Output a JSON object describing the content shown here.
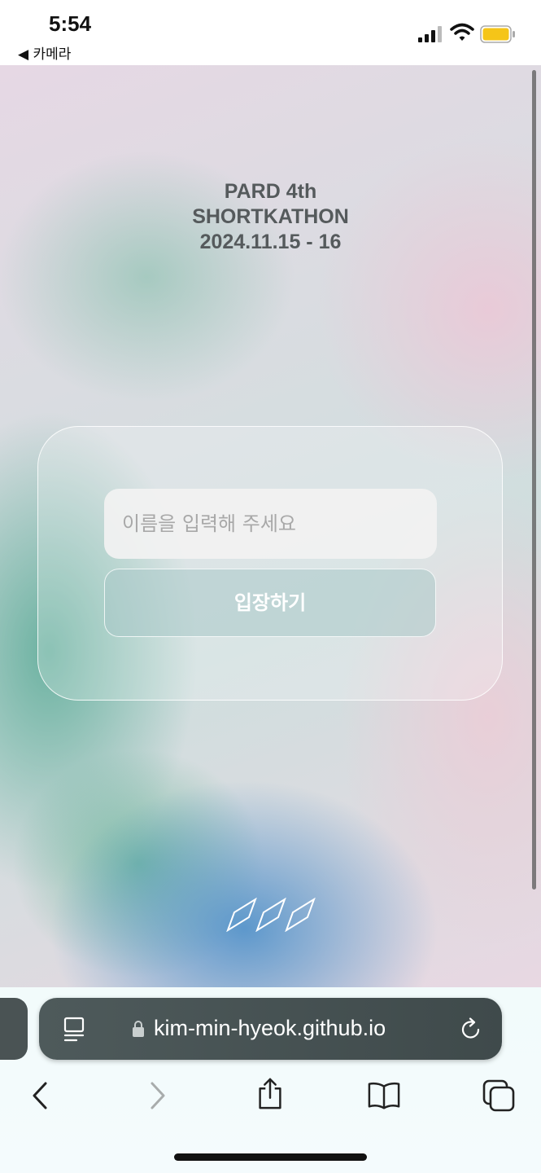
{
  "status_bar": {
    "time": "5:54",
    "back_app": "◀ 카메라",
    "battery_color": "#f5c518"
  },
  "page": {
    "event_title_line1": "PARD 4th",
    "event_title_line2": "SHORTKATHON",
    "event_dates": "2024.11.15 - 16",
    "name_input": {
      "placeholder": "이름을 입력해 주세요",
      "value": ""
    },
    "enter_button_label": "입장하기",
    "logo": "pard-logo-icon"
  },
  "browser": {
    "url": "kim-min-hyeok.github.io",
    "toolbar": [
      "back-icon",
      "forward-icon",
      "share-icon",
      "bookmarks-icon",
      "tabs-icon"
    ]
  }
}
